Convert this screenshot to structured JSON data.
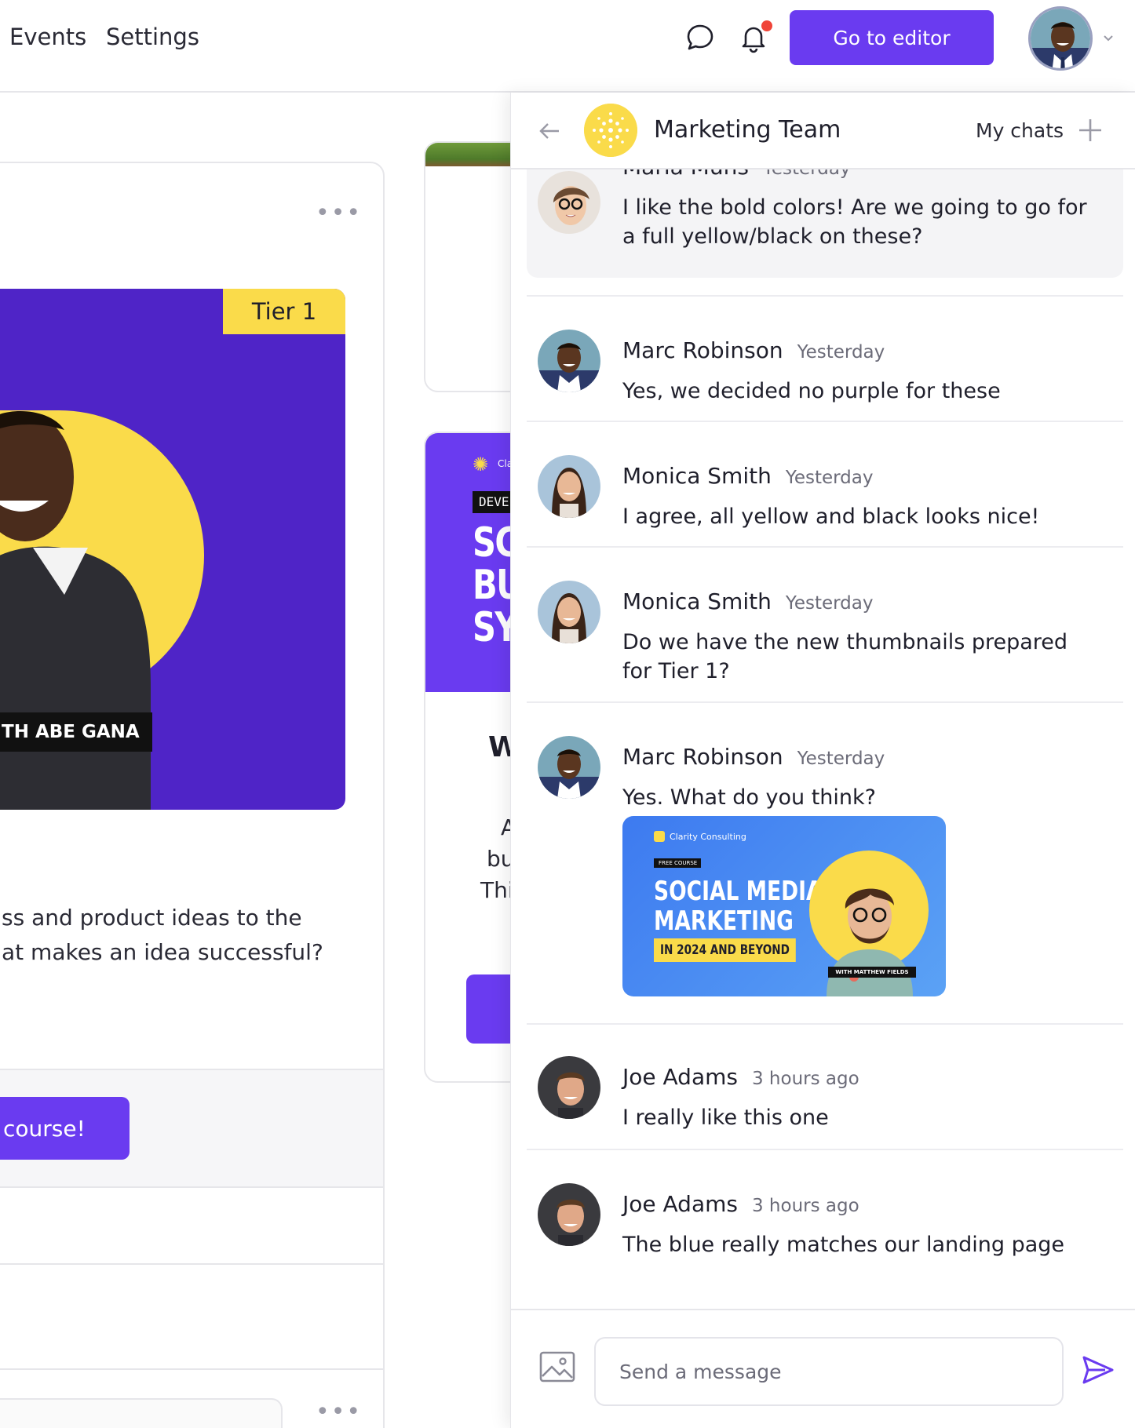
{
  "header": {
    "nav": [
      "Events",
      "Settings"
    ],
    "editor_button": "Go to editor"
  },
  "background": {
    "tier_badge": "Tier 1",
    "promo_strip": "TH ABE GANA",
    "left_text_1": "ss and product ideas to the",
    "left_text_2": "at makes an idea successful?",
    "course_button": "course!",
    "mid_brand": "Cla",
    "mid_tag": "DEVEL",
    "mid_big": [
      "SC",
      "BU",
      "SY"
    ],
    "mid_heading": "W",
    "mid_lines": [
      "A",
      "bu",
      "Thi"
    ]
  },
  "chat": {
    "team_name": "Marketing Team",
    "my_chats": "My chats",
    "messages": [
      {
        "name": "Marla Muns",
        "time": "Yesterday",
        "text": "I like the bold colors! Are we going to go for a full yellow/black on these?"
      },
      {
        "name": "Marc Robinson",
        "time": "Yesterday",
        "text": "Yes, we decided no purple for these"
      },
      {
        "name": "Monica Smith",
        "time": "Yesterday",
        "text": "I agree, all yellow and black looks nice!"
      },
      {
        "name": "Monica Smith",
        "time": "Yesterday",
        "text": "Do we have the new thumbnails prepared for Tier 1?"
      },
      {
        "name": "Marc Robinson",
        "time": "Yesterday",
        "text": "Yes. What do you think?"
      },
      {
        "name": "Joe Adams",
        "time": "3 hours ago",
        "text": "I really like this one"
      },
      {
        "name": "Joe Adams",
        "time": "3 hours ago",
        "text": "The blue really matches our landing page"
      }
    ],
    "attachment": {
      "brand": "Clarity Consulting",
      "tag": "FREE COURSE",
      "title_1": "SOCIAL MEDIA",
      "title_2": "MARKETING",
      "subtitle": "IN 2024 AND BEYOND",
      "strip": "WITH MATTHEW FIELDS"
    },
    "composer_placeholder": "Send a message"
  },
  "colors": {
    "accent": "#6a3bf0",
    "yellow": "#fadb4a",
    "notification": "#f04438",
    "attachment_blue": "#3d7af0"
  }
}
